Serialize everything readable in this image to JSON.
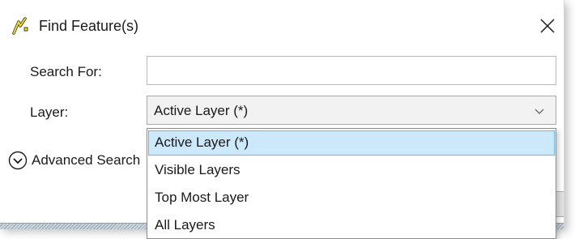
{
  "dialog": {
    "title": "Find Feature(s)",
    "close_label": "✕"
  },
  "form": {
    "search_label": "Search For:",
    "search_value": "",
    "search_placeholder": "",
    "layer_label": "Layer:",
    "layer_value": "Active Layer (*)",
    "advanced_label": "Advanced Search"
  },
  "dropdown": {
    "options": [
      "Active Layer (*)",
      "Visible Layers",
      "Top Most Layer",
      "All Layers"
    ],
    "selected_index": 0
  },
  "colors": {
    "highlight": "#cce8fb",
    "highlight_border": "#66b4f0",
    "icon_yellow": "#f5e31a"
  },
  "icons": {
    "app": "find-feature-icon",
    "close": "close-icon",
    "dropdown": "chevron-down-icon",
    "advanced": "expand-circle-icon"
  }
}
